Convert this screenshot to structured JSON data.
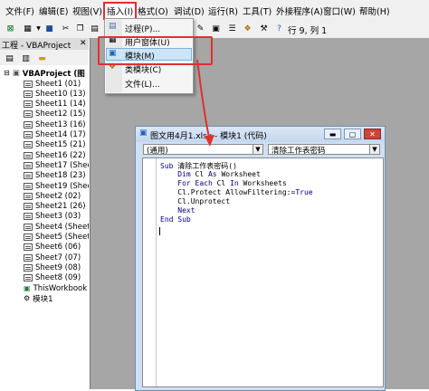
{
  "menubar": {
    "items": [
      "文件(F)",
      "编辑(E)",
      "视图(V)",
      "插入(I)",
      "格式(O)",
      "调试(D)",
      "运行(R)",
      "工具(T)",
      "外接程序(A)",
      "窗口(W)",
      "帮助(H)"
    ]
  },
  "toolbar": {
    "position": "行 9, 列 1"
  },
  "project": {
    "title": "工程 - VBAProject",
    "close": "✕",
    "root": "VBAProject (图",
    "sheets": [
      "Sheet1 (01)",
      "Sheet10 (13)",
      "Sheet11 (14)",
      "Sheet12 (15)",
      "Sheet13 (16)",
      "Sheet14 (17)",
      "Sheet15 (21)",
      "Sheet16 (22)",
      "Sheet17 (Shee",
      "Sheet18 (23)",
      "Sheet19 (Shee",
      "Sheet2 (02)",
      "Sheet21 (26)",
      "Sheet3 (03)",
      "Sheet4 (Sheet",
      "Sheet5 (Sheet",
      "Sheet6 (06)",
      "Sheet7 (07)",
      "Sheet9 (08)",
      "Sheet8 (09)",
      "ThisWorkbook",
      "模块1"
    ]
  },
  "insert_menu": {
    "items": [
      "过程(P)...",
      "用户窗体(U)",
      "模块(M)",
      "类模块(C)",
      "文件(L)..."
    ]
  },
  "code_window": {
    "title": "图文用4月1.xlsx - 模块1 (代码)",
    "object_combo": "(通用)",
    "proc_combo": "清除工作表密码",
    "lines": [
      "Sub 清除工作表密码()",
      "    Dim Cl As Worksheet",
      "    For Each Cl In Worksheets",
      "    Cl.Protect AllowFiltering:=True",
      "    Cl.Unprotect",
      "    Next",
      "End Sub"
    ]
  },
  "colors": {
    "highlight_red": "#e03030",
    "keyword_blue": "#00007f",
    "workspace_gray": "#a6a6a6"
  }
}
